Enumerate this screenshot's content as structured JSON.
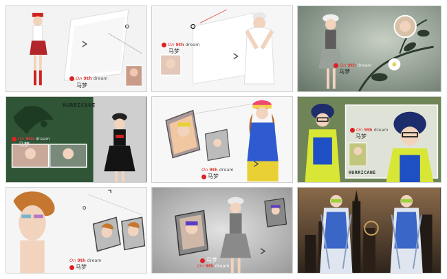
{
  "caption_en_prefix": "On",
  "caption_en_suffix": "dream",
  "caption_num": "9th",
  "caption_cn": "马梦",
  "hurricane_label": "HURRICANE",
  "colors": {
    "accent_red": "#e13b3b",
    "dark_green": "#2f5436",
    "olive_green": "#6f8457",
    "sepia": "#4a3f35"
  }
}
